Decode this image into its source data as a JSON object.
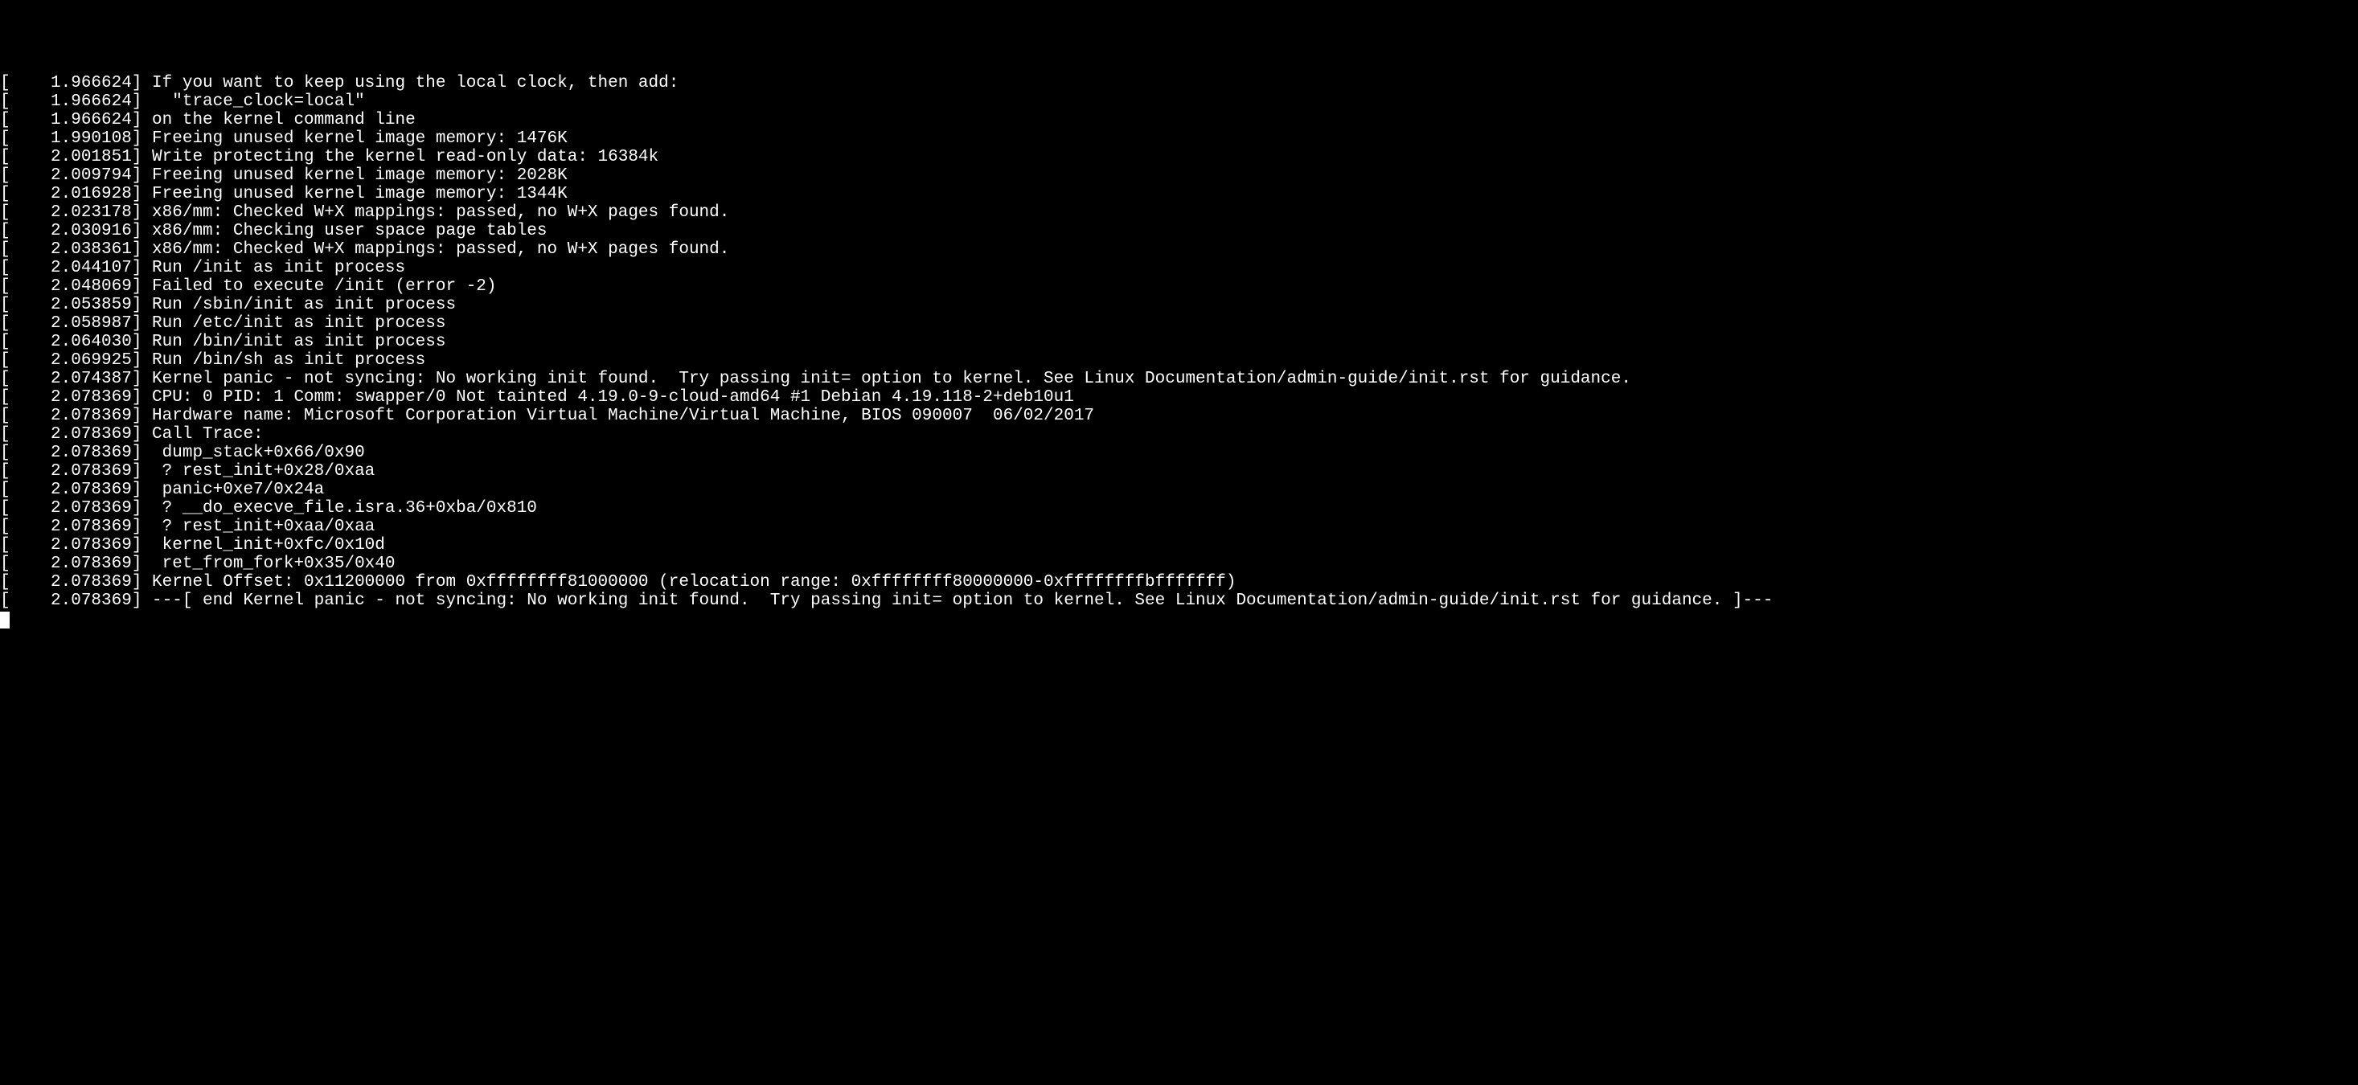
{
  "console": {
    "lines": [
      {
        "ts": "1.966624",
        "msg": "If you want to keep using the local clock, then add:"
      },
      {
        "ts": "1.966624",
        "msg": "  \"trace_clock=local\""
      },
      {
        "ts": "1.966624",
        "msg": "on the kernel command line"
      },
      {
        "ts": "1.990108",
        "msg": "Freeing unused kernel image memory: 1476K"
      },
      {
        "ts": "2.001851",
        "msg": "Write protecting the kernel read-only data: 16384k"
      },
      {
        "ts": "2.009794",
        "msg": "Freeing unused kernel image memory: 2028K"
      },
      {
        "ts": "2.016928",
        "msg": "Freeing unused kernel image memory: 1344K"
      },
      {
        "ts": "2.023178",
        "msg": "x86/mm: Checked W+X mappings: passed, no W+X pages found."
      },
      {
        "ts": "2.030916",
        "msg": "x86/mm: Checking user space page tables"
      },
      {
        "ts": "2.038361",
        "msg": "x86/mm: Checked W+X mappings: passed, no W+X pages found."
      },
      {
        "ts": "2.044107",
        "msg": "Run /init as init process"
      },
      {
        "ts": "2.048069",
        "msg": "Failed to execute /init (error -2)"
      },
      {
        "ts": "2.053859",
        "msg": "Run /sbin/init as init process"
      },
      {
        "ts": "2.058987",
        "msg": "Run /etc/init as init process"
      },
      {
        "ts": "2.064030",
        "msg": "Run /bin/init as init process"
      },
      {
        "ts": "2.069925",
        "msg": "Run /bin/sh as init process"
      },
      {
        "ts": "2.074387",
        "msg": "Kernel panic - not syncing: No working init found.  Try passing init= option to kernel. See Linux Documentation/admin-guide/init.rst for guidance.",
        "wrap": true
      },
      {
        "ts": "2.078369",
        "msg": "CPU: 0 PID: 1 Comm: swapper/0 Not tainted 4.19.0-9-cloud-amd64 #1 Debian 4.19.118-2+deb10u1"
      },
      {
        "ts": "2.078369",
        "msg": "Hardware name: Microsoft Corporation Virtual Machine/Virtual Machine, BIOS 090007  06/02/2017"
      },
      {
        "ts": "2.078369",
        "msg": "Call Trace:"
      },
      {
        "ts": "2.078369",
        "msg": " dump_stack+0x66/0x90"
      },
      {
        "ts": "2.078369",
        "msg": " ? rest_init+0x28/0xaa"
      },
      {
        "ts": "2.078369",
        "msg": " panic+0xe7/0x24a"
      },
      {
        "ts": "2.078369",
        "msg": " ? __do_execve_file.isra.36+0xba/0x810"
      },
      {
        "ts": "2.078369",
        "msg": " ? rest_init+0xaa/0xaa"
      },
      {
        "ts": "2.078369",
        "msg": " kernel_init+0xfc/0x10d"
      },
      {
        "ts": "2.078369",
        "msg": " ret_from_fork+0x35/0x40"
      },
      {
        "ts": "2.078369",
        "msg": "Kernel Offset: 0x11200000 from 0xffffffff81000000 (relocation range: 0xffffffff80000000-0xffffffffbfffffff)"
      },
      {
        "ts": "2.078369",
        "msg": "---[ end Kernel panic - not syncing: No working init found.  Try passing init= option to kernel. See Linux Documentation/admin-guide/init.rst for guidance. ]---",
        "wrap": true
      }
    ]
  }
}
